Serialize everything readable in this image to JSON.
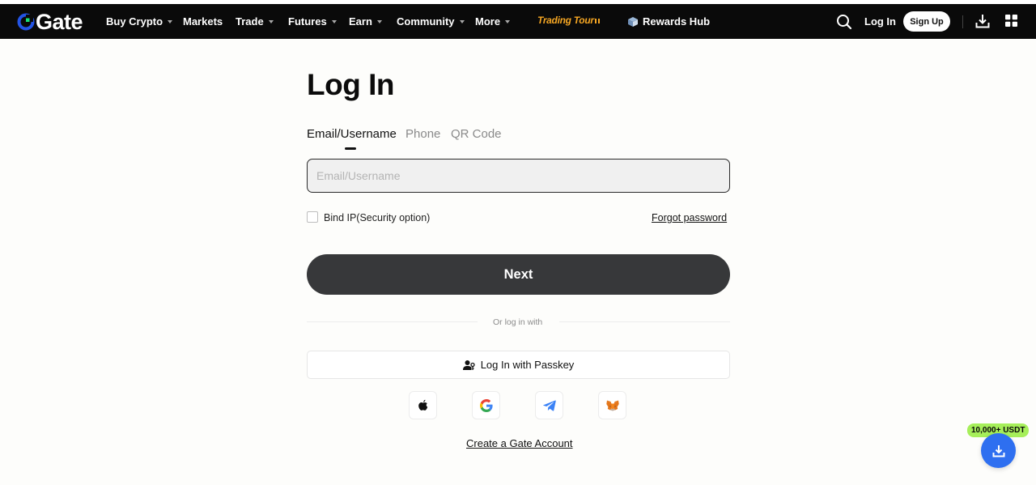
{
  "header": {
    "brand": "Gate",
    "nav": [
      {
        "label": "Buy Crypto",
        "has_dropdown": true
      },
      {
        "label": "Markets",
        "has_dropdown": false
      },
      {
        "label": "Trade",
        "has_dropdown": true
      },
      {
        "label": "Futures",
        "has_dropdown": true
      },
      {
        "label": "Earn",
        "has_dropdown": true
      },
      {
        "label": "Community",
        "has_dropdown": true
      },
      {
        "label": "More",
        "has_dropdown": true
      }
    ],
    "promo": "Trading Tour",
    "rewards": "Rewards Hub",
    "login": "Log In",
    "signup": "Sign Up",
    "icons": {
      "search": "search-icon",
      "download": "download-icon",
      "apps": "grid-icon"
    }
  },
  "login_form": {
    "title": "Log In",
    "tabs": [
      {
        "label": "Email/Username",
        "active": true
      },
      {
        "label": "Phone",
        "active": false
      },
      {
        "label": "QR Code",
        "active": false
      }
    ],
    "input": {
      "value": "",
      "placeholder": "Email/Username"
    },
    "bind_ip_label": "Bind IP(Security option)",
    "bind_ip_checked": false,
    "forgot_password": "Forgot password",
    "next_button": "Next",
    "divider_text": "Or log in with",
    "passkey_button": "Log In with Passkey",
    "social_logins": [
      "apple-icon",
      "google-icon",
      "telegram-icon",
      "metamask-icon"
    ],
    "create_account": "Create a Gate Account"
  },
  "floating": {
    "badge": "10,000+ USDT",
    "button_icon": "download-icon"
  },
  "colors": {
    "nav_background": "#0a0a0a",
    "brand_blue": "#2354e6",
    "brand_green": "#17e07a",
    "primary_button": "#37383a",
    "badge_green": "#a6ef5a",
    "fab_blue": "#2e6ff0"
  }
}
